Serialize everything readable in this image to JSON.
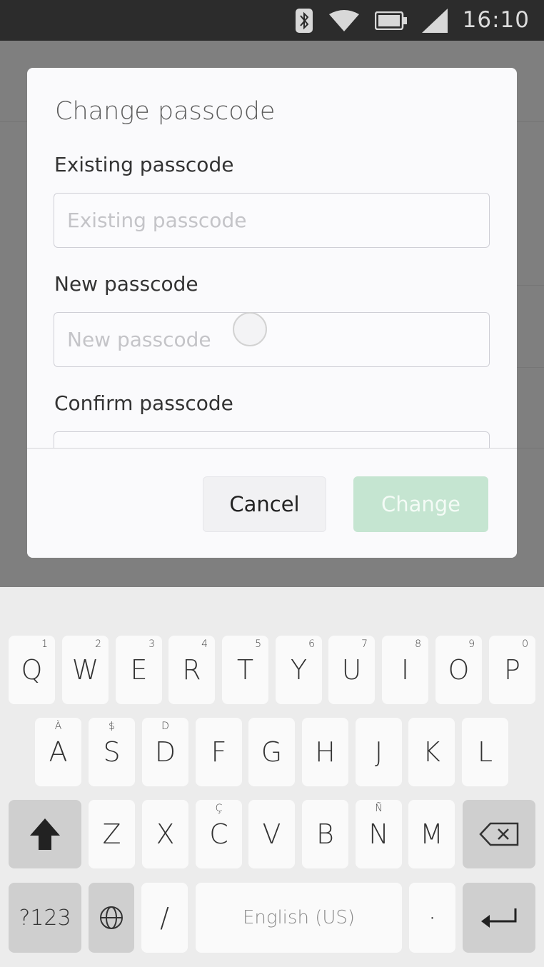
{
  "status_bar": {
    "time": "16:10",
    "icons": [
      "bluetooth-icon",
      "wifi-icon",
      "battery-icon",
      "signal-icon"
    ]
  },
  "dialog": {
    "title": "Change passcode",
    "fields": [
      {
        "label": "Existing passcode",
        "placeholder": "Existing passcode",
        "value": ""
      },
      {
        "label": "New passcode",
        "placeholder": "New passcode",
        "value": ""
      },
      {
        "label": "Confirm passcode",
        "placeholder": "",
        "value": ""
      }
    ],
    "cancel_label": "Cancel",
    "change_label": "Change"
  },
  "keyboard": {
    "row1": [
      {
        "key": "Q",
        "hint": "1"
      },
      {
        "key": "W",
        "hint": "2"
      },
      {
        "key": "E",
        "hint": "3"
      },
      {
        "key": "R",
        "hint": "4"
      },
      {
        "key": "T",
        "hint": "5"
      },
      {
        "key": "Y",
        "hint": "6"
      },
      {
        "key": "U",
        "hint": "7"
      },
      {
        "key": "I",
        "hint": "8"
      },
      {
        "key": "O",
        "hint": "9"
      },
      {
        "key": "P",
        "hint": "0"
      }
    ],
    "row2": [
      {
        "key": "A",
        "hint": "Ä"
      },
      {
        "key": "S",
        "hint": "$"
      },
      {
        "key": "D",
        "hint": "D"
      },
      {
        "key": "F",
        "hint": ""
      },
      {
        "key": "G",
        "hint": ""
      },
      {
        "key": "H",
        "hint": ""
      },
      {
        "key": "J",
        "hint": ""
      },
      {
        "key": "K",
        "hint": ""
      },
      {
        "key": "L",
        "hint": ""
      }
    ],
    "row3": [
      {
        "key": "Z",
        "hint": ""
      },
      {
        "key": "X",
        "hint": ""
      },
      {
        "key": "C",
        "hint": "Ç"
      },
      {
        "key": "V",
        "hint": ""
      },
      {
        "key": "B",
        "hint": ""
      },
      {
        "key": "N",
        "hint": "Ñ"
      },
      {
        "key": "M",
        "hint": ""
      }
    ],
    "symbols_label": "?123",
    "slash_label": "/",
    "space_label": "English (US)",
    "period_label": "·"
  },
  "colors": {
    "change_button_bg": "#c5e5d1",
    "status_bar_bg": "#2c2c2c",
    "scrim": "#7f7f7f"
  }
}
